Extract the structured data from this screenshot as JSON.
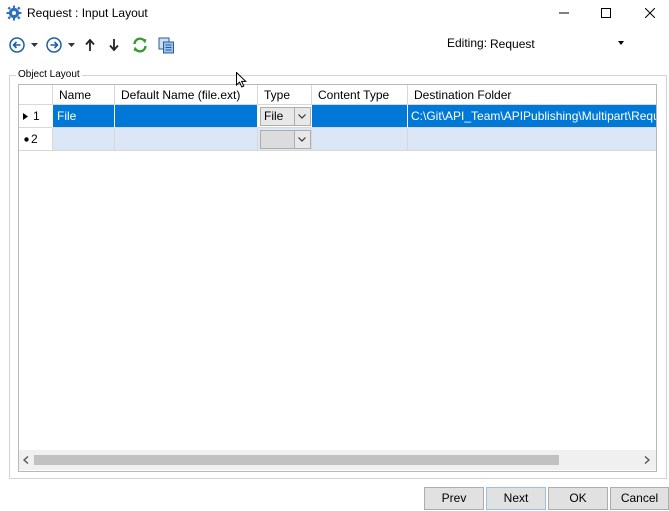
{
  "window": {
    "title": "Request : Input Layout",
    "controls": [
      "minimize-icon",
      "maximize-icon",
      "close-icon"
    ]
  },
  "toolbar": {
    "icons": [
      "back-circle-icon",
      "dropdown-caret-icon",
      "forward-circle-icon",
      "dropdown-caret-icon",
      "arrow-up-icon",
      "arrow-down-icon",
      "refresh-icon",
      "copy-icon"
    ],
    "editing_label": "Editing:",
    "editing_value": "Request"
  },
  "group": {
    "label": "Object Layout"
  },
  "grid": {
    "columns": [
      "Name",
      "Default Name (file.ext)",
      "Type",
      "Content Type",
      "Destination Folder"
    ],
    "rows": [
      {
        "num": "1",
        "name": "File",
        "default_name": "",
        "type": "File",
        "content_type": "",
        "destination_folder": "C:\\Git\\API_Team\\APIPublishing\\Multipart\\Reque",
        "selected": true
      },
      {
        "num": "2",
        "name": "",
        "default_name": "",
        "type": "",
        "content_type": "",
        "destination_folder": "",
        "selected": false
      }
    ]
  },
  "buttons": {
    "prev": "Prev",
    "next": "Next",
    "ok": "OK",
    "cancel": "Cancel"
  },
  "colors": {
    "selection": "#0078d7",
    "new_row": "#dbe6f6",
    "refresh_icon": "#2e9c2e",
    "nav_icon": "#1e5fa8"
  }
}
